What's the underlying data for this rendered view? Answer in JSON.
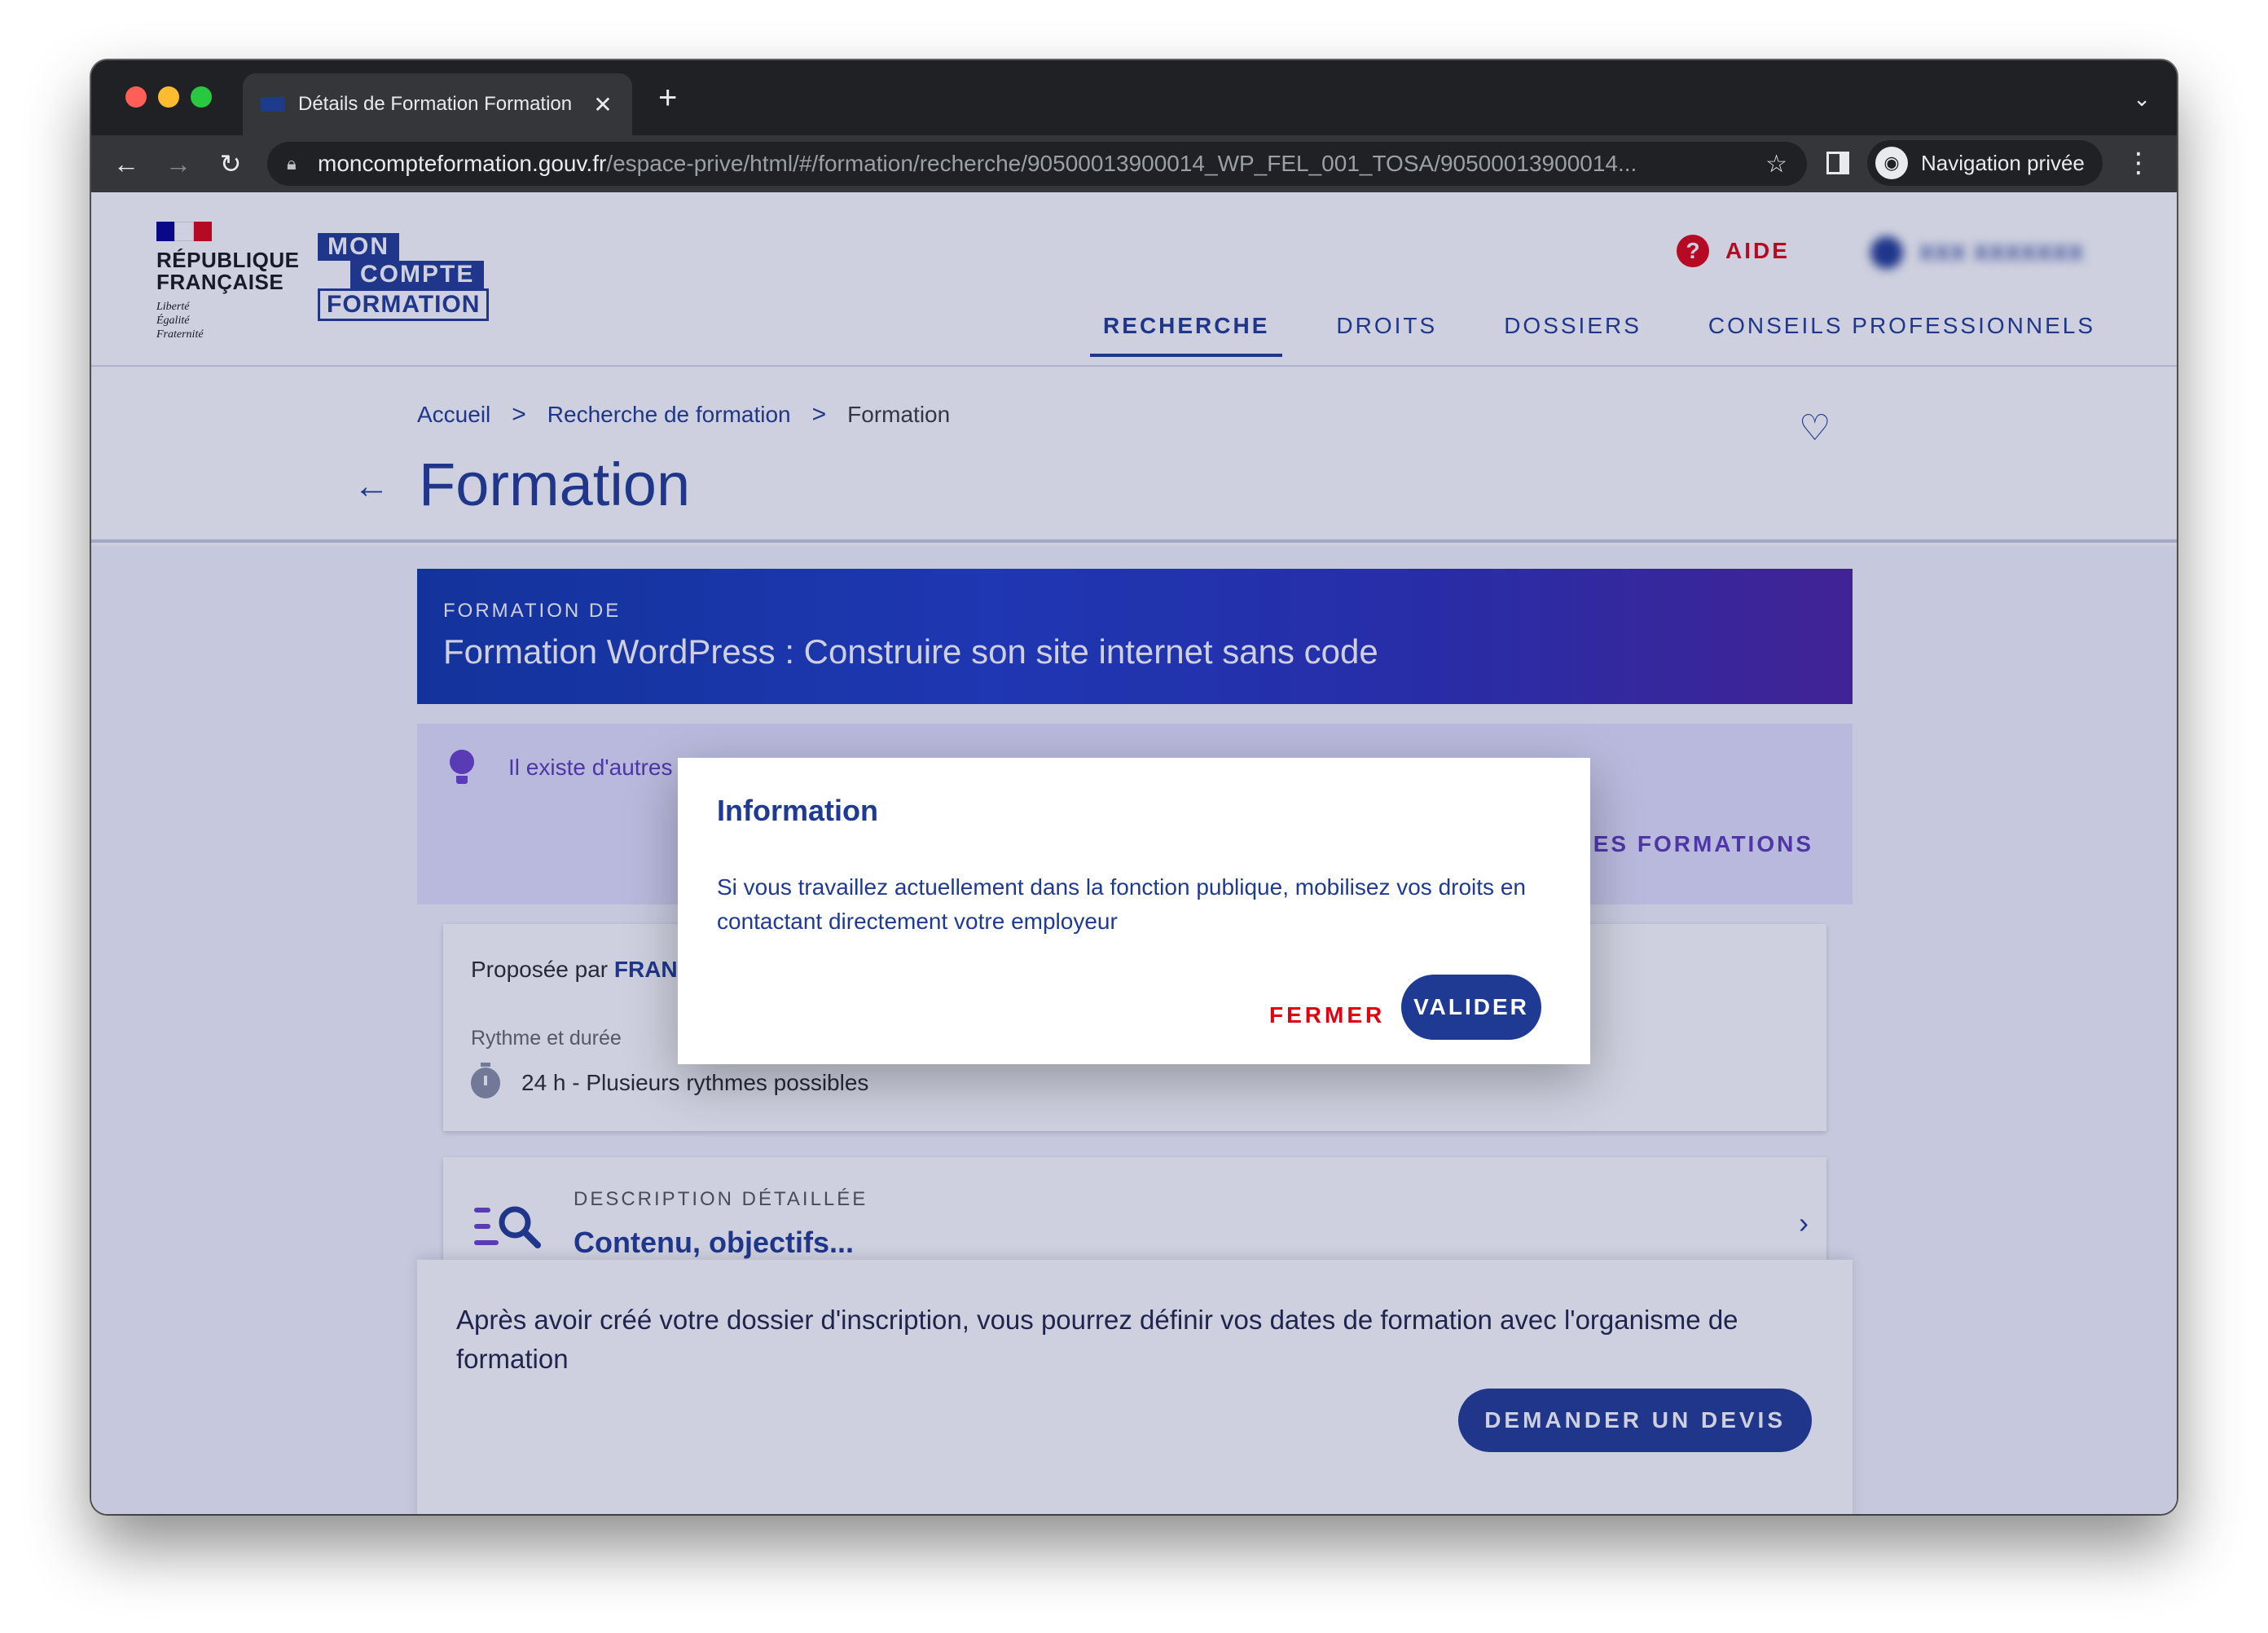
{
  "browser": {
    "tab_title": "Détails de Formation Formation",
    "tab_close": "✕",
    "new_tab": "+",
    "tab_menu": "⌄",
    "url_host": "moncompteformation.gouv.fr",
    "url_path": "/espace-prive/html/#/formation/recherche/90500013900014_WP_FEL_001_TOSA/90500013900014...",
    "incognito_label": "Navigation privée"
  },
  "header": {
    "rf_name": [
      "RÉPUBLIQUE",
      "FRANÇAISE"
    ],
    "rf_motto": [
      "Liberté",
      "Égalité",
      "Fraternité"
    ],
    "mcf_logo": [
      "MON",
      "COMPTE",
      "FORMATION"
    ],
    "aide_label": "AIDE",
    "user_name": "XXX XXXXXXX",
    "nav": [
      {
        "label": "RECHERCHE",
        "active": true
      },
      {
        "label": "DROITS",
        "active": false
      },
      {
        "label": "DOSSIERS",
        "active": false
      },
      {
        "label": "CONSEILS PROFESSIONNELS",
        "active": false
      }
    ]
  },
  "breadcrumb": {
    "home": "Accueil",
    "search": "Recherche de formation",
    "current": "Formation",
    "separator": ">"
  },
  "page_title": "Formation",
  "banner": {
    "kicker": "FORMATION DE",
    "title": "Formation WordPress : Construire son site internet sans code"
  },
  "tip": {
    "text": "Il existe d'autres",
    "link": "RES FORMATIONS"
  },
  "provider_card": {
    "prefix": "Proposée par ",
    "name": "FRAN",
    "rhythm_label": "Rythme et durée",
    "duration": "24 h -  Plusieurs rythmes possibles"
  },
  "description_card": {
    "kicker": "DESCRIPTION DÉTAILLÉE",
    "title": "Contenu, objectifs..."
  },
  "footer": {
    "text": "Après avoir créé votre dossier d'inscription, vous pourrez définir vos dates de formation avec l'organisme de formation",
    "button": "DEMANDER UN DEVIS"
  },
  "modal": {
    "title": "Information",
    "body": "Si vous travaillez actuellement dans la fonction publique, mobilisez vos droits en contactant directement votre employeur",
    "close_label": "FERMER",
    "ok_label": "VALIDER"
  },
  "colors": {
    "brand_blue": "#1f3a93",
    "marianne_red": "#e1000f",
    "tip_purple": "#5b3ab8"
  },
  "icons": {
    "back": "arrow-left-icon",
    "favorite": "heart-icon",
    "help": "question-icon",
    "tip": "lightbulb-icon",
    "timer": "stopwatch-icon",
    "description": "list-search-icon",
    "chevron": "chevron-right-icon"
  }
}
